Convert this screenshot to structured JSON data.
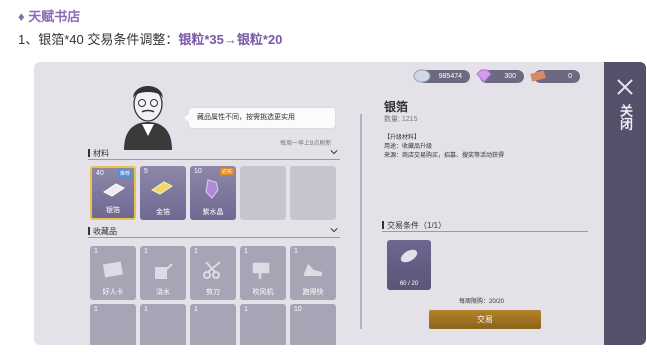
{
  "article": {
    "title": "♦ 天赋书店",
    "line_prefix": "1、银箔*40 交易条件调整：",
    "line_highlight": "银粒*35→银粒*20"
  },
  "npc": {
    "bubble": "藏品属性不同，按需挑选更实用",
    "refresh": "每周一早上8点刷新"
  },
  "materials": {
    "title": "材料",
    "slots": [
      {
        "count": "40",
        "label": "银箔",
        "tag": "推荐"
      },
      {
        "count": "5",
        "label": "金箔",
        "tag": ""
      },
      {
        "count": "10",
        "label": "紫水晶",
        "tag": "必买"
      }
    ]
  },
  "collection": {
    "title": "收藏品",
    "slots": [
      {
        "count": "1",
        "label": "好人卡"
      },
      {
        "count": "1",
        "label": "浇水"
      },
      {
        "count": "1",
        "label": "剪刀"
      },
      {
        "count": "1",
        "label": "吹风机"
      },
      {
        "count": "1",
        "label": "跑得快"
      }
    ],
    "row2_counts": [
      "1",
      "1",
      "1",
      "1",
      "10"
    ]
  },
  "currency": [
    {
      "value": "985474",
      "icon": "silver-coin-icon"
    },
    {
      "value": "300",
      "icon": "gem-icon"
    },
    {
      "value": "0",
      "icon": "ticket-icon"
    }
  ],
  "detail": {
    "name": "银箔",
    "quantity": "数量: 1215",
    "upgrade_title": "【升级材料】",
    "usage": "用途：收藏品升级",
    "source": "来源：商店交易购买，招募、搜奖等活动获得"
  },
  "trade": {
    "title": "交易条件（1/1）",
    "req_count": "60 / 20",
    "limit": "每周限购：20/20",
    "button": "交易"
  },
  "close": {
    "label": "关闭"
  }
}
